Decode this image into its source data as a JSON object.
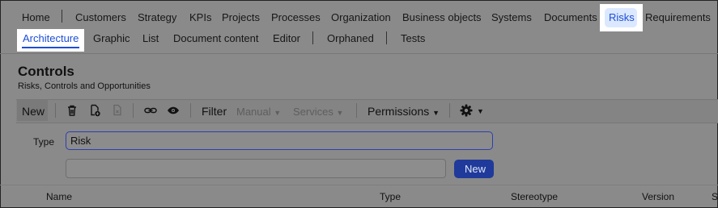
{
  "nav_primary": {
    "items": [
      "Home",
      "Customers",
      "Strategy",
      "KPIs",
      "Projects",
      "Processes",
      "Organization",
      "Business objects",
      "Systems",
      "Documents",
      "Risks",
      "Requirements"
    ],
    "active": "Risks"
  },
  "nav_secondary": {
    "items": [
      "Architecture",
      "Graphic",
      "List",
      "Document content",
      "Editor",
      "Orphaned",
      "Tests"
    ],
    "active": "Architecture"
  },
  "header": {
    "title": "Controls",
    "subtitle": "Risks, Controls and Opportunities"
  },
  "toolbar": {
    "new_label": "New",
    "filter_label": "Filter",
    "manual_label": "Manual",
    "services_label": "Services",
    "permissions_label": "Permissions",
    "icons": [
      "trash-icon",
      "new-document-icon",
      "document-disabled-icon",
      "link-icon",
      "eye-icon",
      "gear-icon"
    ]
  },
  "form": {
    "type_label": "Type",
    "type_value": "Risk",
    "second_value": "",
    "new_button_label": "New"
  },
  "table": {
    "columns": [
      "Name",
      "Type",
      "Stereotype",
      "Version",
      "S"
    ]
  },
  "colors": {
    "accent": "#1d4ed8",
    "active_pill": "#dbe8ff",
    "overlay": "#8a8a8a"
  }
}
